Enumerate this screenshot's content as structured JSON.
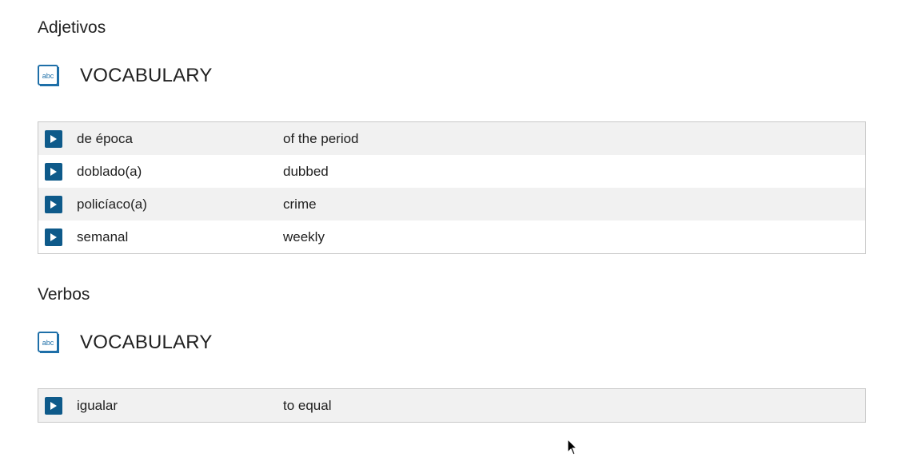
{
  "sections": [
    {
      "heading": "Adjetivos",
      "vocab_label": "VOCABULARY",
      "icon": "abc-book-icon",
      "rows": [
        {
          "term": "de época",
          "meaning": "of the period"
        },
        {
          "term": "doblado(a)",
          "meaning": "dubbed"
        },
        {
          "term": "policíaco(a)",
          "meaning": "crime"
        },
        {
          "term": "semanal",
          "meaning": "weekly"
        }
      ]
    },
    {
      "heading": "Verbos",
      "vocab_label": "VOCABULARY",
      "icon": "abc-book-icon",
      "rows": [
        {
          "term": "igualar",
          "meaning": "to equal"
        }
      ]
    }
  ],
  "icon_text": "abc",
  "colors": {
    "play_button": "#0e5a8a",
    "row_alt": "#f1f1f1",
    "border": "#c8c8c8"
  }
}
